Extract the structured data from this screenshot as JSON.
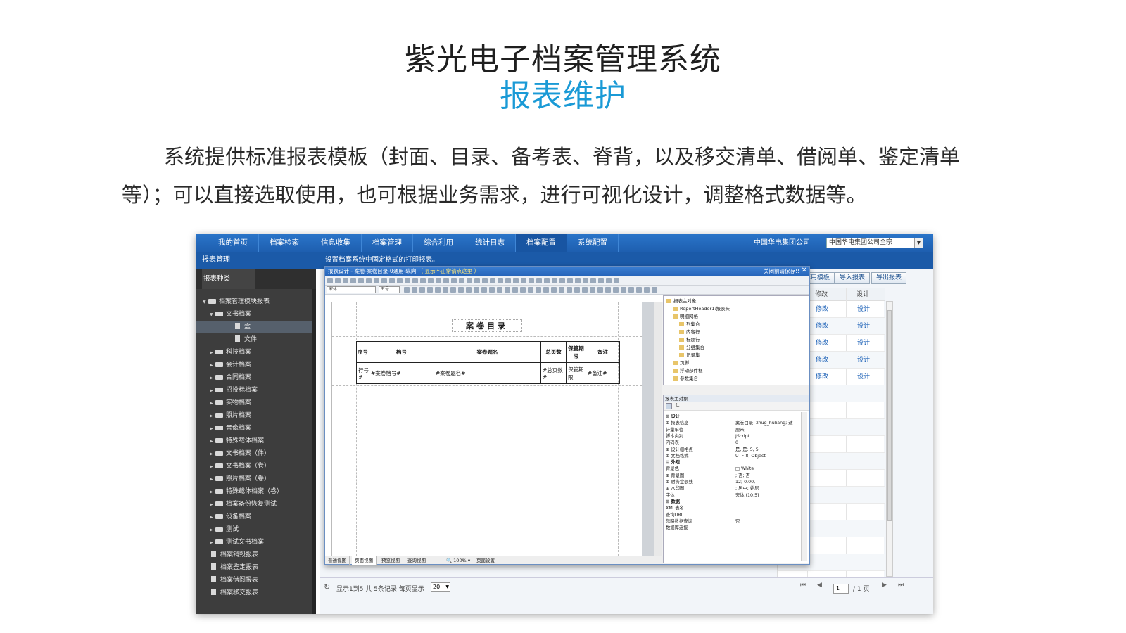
{
  "heading": {
    "title": "紫光电子档案管理系统",
    "subtitle": "报表维护",
    "description": "系统提供标准报表模板（封面、目录、备考表、脊背，以及移交清单、借阅单、鉴定清单等）；可以直接选取使用，也可根据业务需求，进行可视化设计，调整格式数据等。"
  },
  "nav": {
    "items": [
      "我的首页",
      "档案检索",
      "信息收集",
      "档案管理",
      "综合利用",
      "统计日志",
      "档案配置",
      "系统配置"
    ],
    "active_index": 6,
    "org_label": "中国华电集团公司",
    "org_select": "中国华电集团公司全宗"
  },
  "subbar": {
    "section": "报表管理",
    "hint": "设置档案系统中固定格式的打印报表。"
  },
  "sidebar": {
    "header": "报表种类",
    "items": [
      {
        "label": "档案管理模块报表",
        "level": 0,
        "type": "folder",
        "open": true
      },
      {
        "label": "文书档案",
        "level": 1,
        "type": "folder",
        "open": true
      },
      {
        "label": "盒",
        "level": 2,
        "type": "doc",
        "selected": true
      },
      {
        "label": "文件",
        "level": 2,
        "type": "doc"
      },
      {
        "label": "科技档案",
        "level": 1,
        "type": "folder"
      },
      {
        "label": "会计档案",
        "level": 1,
        "type": "folder"
      },
      {
        "label": "合同档案",
        "level": 1,
        "type": "folder"
      },
      {
        "label": "招投标档案",
        "level": 1,
        "type": "folder"
      },
      {
        "label": "实物档案",
        "level": 1,
        "type": "folder"
      },
      {
        "label": "照片档案",
        "level": 1,
        "type": "folder"
      },
      {
        "label": "音像档案",
        "level": 1,
        "type": "folder"
      },
      {
        "label": "特殊载体档案",
        "level": 1,
        "type": "folder"
      },
      {
        "label": "文书档案（件）",
        "level": 1,
        "type": "folder"
      },
      {
        "label": "文书档案（卷）",
        "level": 1,
        "type": "folder"
      },
      {
        "label": "照片档案（卷）",
        "level": 1,
        "type": "folder"
      },
      {
        "label": "特殊载体档案（卷）",
        "level": 1,
        "type": "folder"
      },
      {
        "label": "档案备份恢复测试",
        "level": 1,
        "type": "folder"
      },
      {
        "label": "设备档案",
        "level": 1,
        "type": "folder"
      },
      {
        "label": "测试",
        "level": 1,
        "type": "folder"
      },
      {
        "label": "测试文书档案",
        "level": 1,
        "type": "folder"
      },
      {
        "label": "档案销毁报表",
        "level": 0,
        "type": "doc"
      },
      {
        "label": "档案鉴定报表",
        "level": 0,
        "type": "doc"
      },
      {
        "label": "档案借阅报表",
        "level": 0,
        "type": "doc"
      },
      {
        "label": "档案移交报表",
        "level": 0,
        "type": "doc"
      }
    ]
  },
  "toolbar": {
    "buttons": [
      "套用模板",
      "导入报表",
      "导出报表"
    ]
  },
  "grid": {
    "headers": [
      "修改",
      "设计"
    ],
    "rows": [
      {
        "edit": "修改",
        "design": "设计"
      },
      {
        "edit": "修改",
        "design": "设计"
      },
      {
        "edit": "修改",
        "design": "设计"
      },
      {
        "edit": "修改",
        "design": "设计"
      },
      {
        "edit": "修改",
        "design": "设计"
      }
    ]
  },
  "pager": {
    "summary": "显示1到5  共 5条记录  每页显示",
    "page_size": "20",
    "page_input": "1",
    "page_total": "/ 1 页"
  },
  "dialog": {
    "title": "报表设计 - 案卷-案卷目录-0通用-纵向",
    "warning": "（ 显示不正常请点这里 ）",
    "close_hint": "关闭前请保存!!",
    "font_name": "宋体",
    "font_size": "五号",
    "zoom": "100%",
    "report_title": "案卷目录",
    "table_headers": [
      "序号",
      "档号",
      "案卷题名",
      "总页数",
      "保管期限",
      "备注"
    ],
    "table_fields": [
      "行号#",
      "#案卷档号#",
      "#案卷题名#",
      "#总页数#",
      "保管期限",
      "#备注#"
    ],
    "views": [
      "普通视图",
      "页面视图",
      "预览视图",
      "查询视图",
      "页面设置"
    ],
    "active_view": 1,
    "object_tree": [
      {
        "label": "报表主对象",
        "indent": 0
      },
      {
        "label": "ReportHeader1:报表头",
        "indent": 1
      },
      {
        "label": "明细网格",
        "indent": 1
      },
      {
        "label": "列集合",
        "indent": 2
      },
      {
        "label": "内容行",
        "indent": 2
      },
      {
        "label": "标题行",
        "indent": 2
      },
      {
        "label": "分组集合",
        "indent": 2
      },
      {
        "label": "记录集",
        "indent": 2
      },
      {
        "label": "页脚",
        "indent": 1
      },
      {
        "label": "浮动部件框",
        "indent": 1
      },
      {
        "label": "参数集合",
        "indent": 1
      }
    ],
    "prop_header": "报表主对象",
    "props": [
      {
        "k": "⊟ 设计",
        "v": "",
        "group": true
      },
      {
        "k": "⊞ 报表信息",
        "v": "案卷目录: zhug_huliang; 适"
      },
      {
        "k": "   计量单位",
        "v": "厘米"
      },
      {
        "k": "   脚本类别",
        "v": "JScript"
      },
      {
        "k": "   内码表",
        "v": "0"
      },
      {
        "k": "⊞ 设计栅格点",
        "v": "是, 是: 5, 5"
      },
      {
        "k": "⊞ 文档格式",
        "v": "UTF-8, Object"
      },
      {
        "k": "⊟ 外观",
        "v": "",
        "group": true
      },
      {
        "k": "   背景色",
        "v": "□ White"
      },
      {
        "k": "⊞ 背景图",
        "v": "; 否; 否"
      },
      {
        "k": "⊞ 财务金额线",
        "v": "12; 0.00,"
      },
      {
        "k": "⊞ 水印图",
        "v": "; 居中; 始居"
      },
      {
        "k": "   字体",
        "v": "宋体 (10.5)"
      },
      {
        "k": "⊟ 数据",
        "v": "",
        "group": true
      },
      {
        "k": "   XML表名",
        "v": ""
      },
      {
        "k": "   查询URL",
        "v": ""
      },
      {
        "k": "   忽略数据查询",
        "v": "否"
      },
      {
        "k": "   数据库连接",
        "v": ""
      }
    ]
  }
}
